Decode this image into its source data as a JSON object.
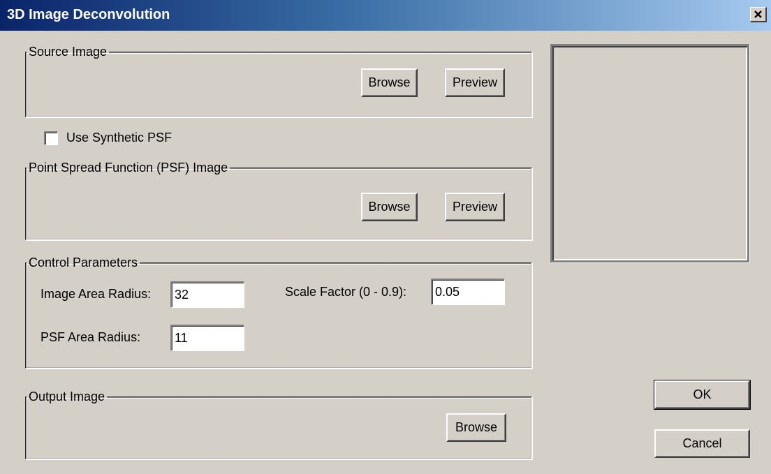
{
  "window": {
    "title": "3D Image Deconvolution"
  },
  "source_image": {
    "legend": "Source Image",
    "browse_label": "Browse",
    "preview_label": "Preview"
  },
  "synthetic_psf": {
    "label": "Use Synthetic PSF",
    "checked": false
  },
  "psf_image": {
    "legend": "Point Spread Function (PSF) Image",
    "browse_label": "Browse",
    "preview_label": "Preview"
  },
  "control_parameters": {
    "legend": "Control Parameters",
    "image_area_radius_label": "Image Area Radius:",
    "image_area_radius_value": "32",
    "psf_area_radius_label": "PSF Area Radius:",
    "psf_area_radius_value": "11",
    "scale_factor_label": "Scale Factor (0 - 0.9):",
    "scale_factor_value": "0.05"
  },
  "output_image": {
    "legend": "Output Image",
    "browse_label": "Browse"
  },
  "actions": {
    "ok_label": "OK",
    "cancel_label": "Cancel"
  },
  "colors": {
    "dialog_background": "#d4d0c8",
    "titlebar_start": "#0a246a",
    "titlebar_end": "#a6caf0",
    "title_text": "#ffffff"
  }
}
